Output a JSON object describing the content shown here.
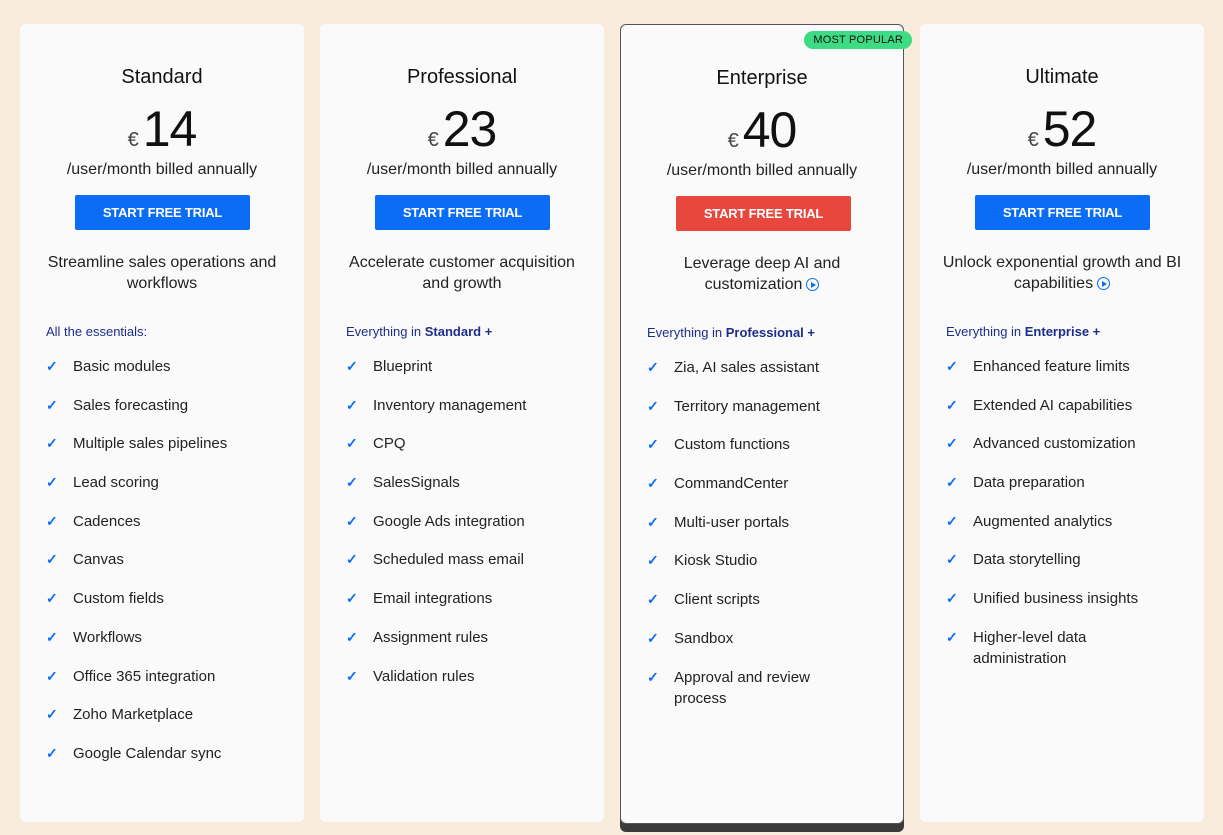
{
  "plans": [
    {
      "name": "Standard",
      "currency": "€",
      "price": "14",
      "billing": "/user/month billed annually",
      "cta": "START FREE TRIAL",
      "tagline": "Streamline sales operations and workflows",
      "group_label_prefix": "All the essentials:",
      "group_label_bold": "",
      "features": [
        "Basic modules",
        "Sales forecasting",
        "Multiple sales pipelines",
        "Lead scoring",
        "Cadences",
        "Canvas",
        "Custom fields",
        "Workflows",
        "Office 365 integration",
        "Zoho Marketplace",
        "Google Calendar sync"
      ]
    },
    {
      "name": "Professional",
      "currency": "€",
      "price": "23",
      "billing": "/user/month billed annually",
      "cta": "START FREE TRIAL",
      "tagline": "Accelerate customer acquisition and growth",
      "group_label_prefix": "Everything in ",
      "group_label_bold": "Standard +",
      "features": [
        "Blueprint",
        "Inventory management",
        "CPQ",
        "SalesSignals",
        "Google Ads integration",
        "Scheduled mass email",
        "Email integrations",
        "Assignment rules",
        "Validation rules"
      ]
    },
    {
      "name": "Enterprise",
      "badge": "MOST POPULAR",
      "currency": "€",
      "price": "40",
      "billing": "/user/month billed annually",
      "cta": "START FREE TRIAL",
      "tagline": "Leverage deep AI and customization",
      "group_label_prefix": "Everything in ",
      "group_label_bold": "Professional +",
      "features": [
        "Zia, AI sales assistant",
        "Territory management",
        "Custom functions",
        "CommandCenter",
        "Multi-user portals",
        "Kiosk Studio",
        "Client scripts",
        "Sandbox",
        "Approval and review process"
      ]
    },
    {
      "name": "Ultimate",
      "currency": "€",
      "price": "52",
      "billing": "/user/month billed annually",
      "cta": "START FREE TRIAL",
      "tagline": "Unlock exponential growth and BI capabilities",
      "group_label_prefix": "Everything in ",
      "group_label_bold": "Enterprise +",
      "features": [
        "Enhanced feature limits",
        "Extended AI capabilities",
        "Advanced customization",
        "Data preparation",
        "Augmented analytics",
        "Data storytelling",
        "Unified business insights",
        "Higher-level data administration"
      ]
    }
  ],
  "colors": {
    "background": "#f9ecdd",
    "cta_blue": "#0b6cf5",
    "cta_featured": "#e8473e",
    "badge": "#3ddc84"
  },
  "icons": {
    "check": "check-icon",
    "play": "play-circle-icon"
  }
}
